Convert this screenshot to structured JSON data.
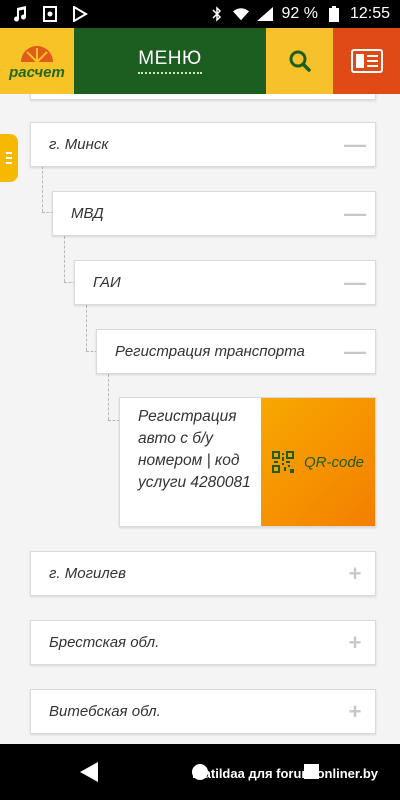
{
  "status_bar": {
    "battery_percent": "92 %",
    "time": "12:55",
    "left_icons": [
      "music-note-icon",
      "photo-icon",
      "play-store-icon"
    ],
    "right_icons": [
      "bluetooth-icon",
      "wifi-icon",
      "signal-icon",
      "battery-icon"
    ]
  },
  "header": {
    "logo_text": "расчет",
    "menu_label": "МЕНЮ",
    "colors": {
      "menu_bg": "#1b5e20",
      "accent_yellow": "#f6c12b",
      "accent_red": "#e04a17"
    }
  },
  "tree": {
    "minsk": "г. Минск",
    "mvd": "МВД",
    "gai": "ГАИ",
    "registration": "Регистрация транспорта",
    "service_text": "Регистрация авто с б/у номером | код услуги 4280081",
    "qr_label": "QR-code",
    "regions": [
      "г. Могилев",
      "Брестская обл.",
      "Витебская обл."
    ],
    "collapse_symbol": "—",
    "expand_symbol": "+"
  },
  "watermark": "matildaa для forum.onliner.by"
}
